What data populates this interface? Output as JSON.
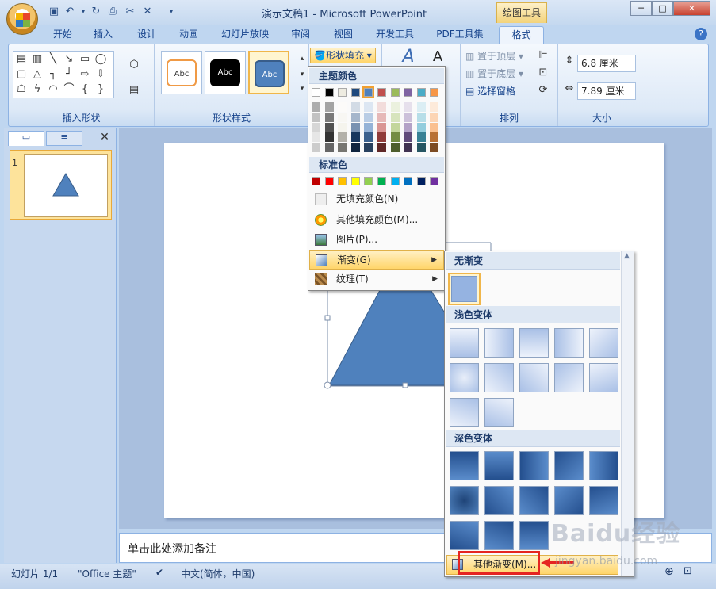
{
  "window": {
    "title": "演示文稿1 - Microsoft PowerPoint",
    "context_tab": "绘图工具",
    "buttons": [
      "─",
      "□",
      "✕"
    ]
  },
  "tabs": [
    {
      "label": "开始"
    },
    {
      "label": "插入"
    },
    {
      "label": "设计"
    },
    {
      "label": "动画"
    },
    {
      "label": "幻灯片放映"
    },
    {
      "label": "审阅"
    },
    {
      "label": "视图"
    },
    {
      "label": "开发工具"
    },
    {
      "label": "PDF工具集"
    },
    {
      "label": "格式"
    }
  ],
  "active_tab": "格式",
  "ribbon": {
    "groups": {
      "insert_shapes": "插入形状",
      "shape_styles": "形状样式",
      "arrange": "排列",
      "size": "大小"
    },
    "style_sample_text": "Abc",
    "shape_fill_label": "形状填充",
    "arrange_items": [
      "置于顶层",
      "置于底层",
      "选择窗格"
    ],
    "size": {
      "height": "6.8 厘米",
      "width": "7.89 厘米"
    }
  },
  "fill_menu": {
    "theme_colors_header": "主题颜色",
    "standard_colors_header": "标准色",
    "theme_colors_row": [
      "#ffffff",
      "#000000",
      "#eeece1",
      "#1f497d",
      "#4f81bd",
      "#c0504d",
      "#9bbb59",
      "#8064a2",
      "#4bacc6",
      "#f79646"
    ],
    "standard_colors": [
      "#c00000",
      "#ff0000",
      "#ffc000",
      "#ffff00",
      "#92d050",
      "#00b050",
      "#00b0f0",
      "#0070c0",
      "#002060",
      "#7030a0"
    ],
    "items": [
      {
        "label": "无填充颜色(N)",
        "icon": "no-fill-icon"
      },
      {
        "label": "其他填充颜色(M)...",
        "icon": "palette-icon"
      },
      {
        "label": "图片(P)...",
        "icon": "picture-icon"
      },
      {
        "label": "渐变(G)",
        "icon": "gradient-icon",
        "highlighted": true,
        "submenu": true
      },
      {
        "label": "纹理(T)",
        "icon": "texture-icon",
        "submenu": true
      }
    ]
  },
  "gradient_menu": {
    "no_gradient": "无渐变",
    "light_variants": "浅色变体",
    "dark_variants": "深色变体",
    "more": "其他渐变(M)..."
  },
  "notes_placeholder": "单击此处添加备注",
  "status": {
    "slide": "幻灯片 1/1",
    "theme": "\"Office 主题\"",
    "language": "中文(简体，中国)"
  },
  "slide_thumb_number": "1",
  "watermark": "Baidu经验",
  "watermark_sub": "jingyan.baidu.com",
  "colors": {
    "shape_fill": "#4f81bd",
    "shape_outline": "#385d8a",
    "highlight": "#ffd56a",
    "annotation_red": "#e52521"
  }
}
